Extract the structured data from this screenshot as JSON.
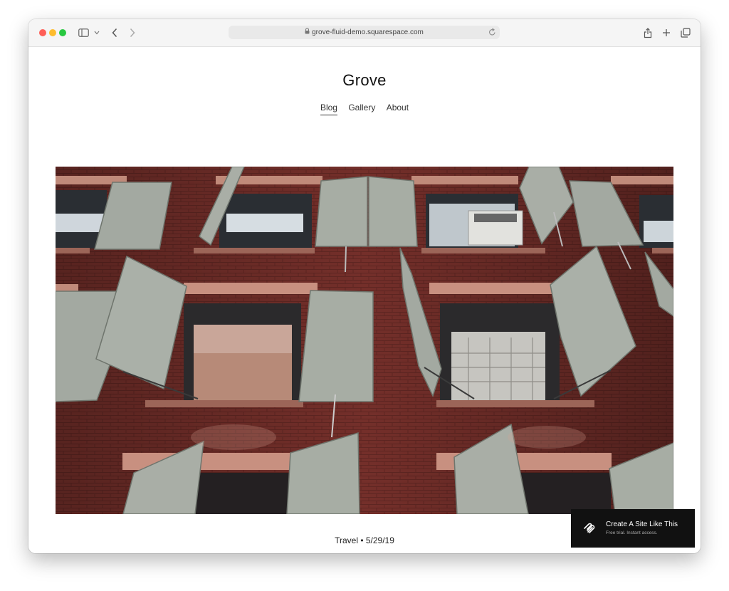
{
  "browser": {
    "url": "grove-fluid-demo.squarespace.com"
  },
  "site": {
    "title": "Grove",
    "nav": [
      {
        "label": "Blog",
        "active": true
      },
      {
        "label": "Gallery",
        "active": false
      },
      {
        "label": "About",
        "active": false
      }
    ]
  },
  "post": {
    "meta": "Travel • 5/29/19"
  },
  "badge": {
    "title": "Create A Site Like This",
    "subtitle": "Free trial. Instant access."
  },
  "colors": {
    "brick": "#722f2a",
    "shutter": "#a9aea6",
    "sill": "#c89080",
    "badge_bg": "#111111"
  },
  "icons": [
    "sidebar-toggle-icon",
    "chevron-down-icon",
    "back-arrow-icon",
    "forward-arrow-icon",
    "lock-icon",
    "reload-icon",
    "share-icon",
    "plus-icon",
    "tabs-icon",
    "squarespace-logo-icon"
  ]
}
